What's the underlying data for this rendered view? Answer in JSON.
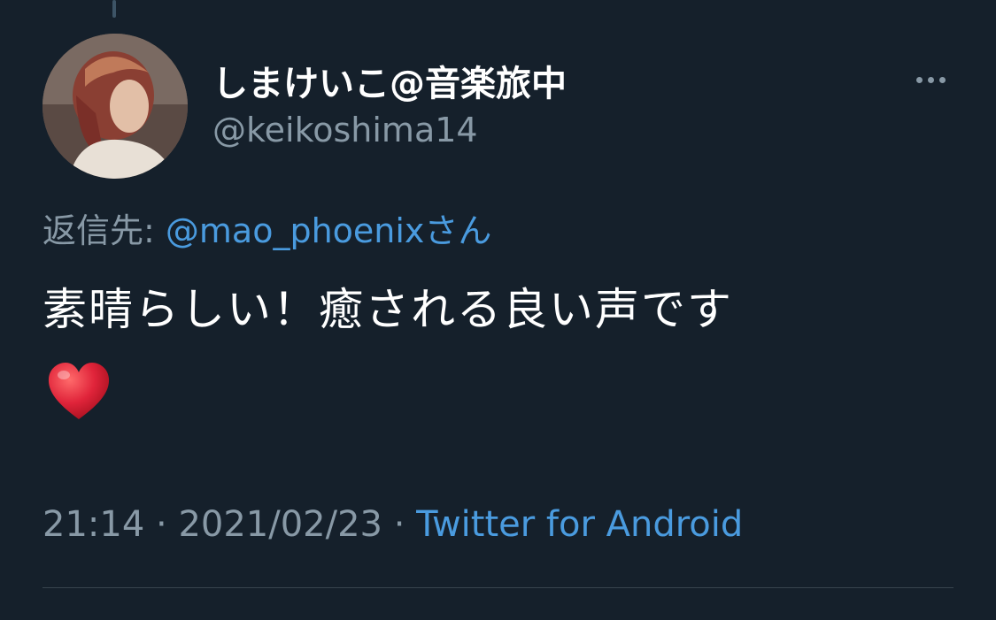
{
  "tweet": {
    "display_name": "しまけいこ@音楽旅中",
    "handle": "@keikoshima14",
    "reply_prefix": "返信先: ",
    "reply_mention": "@mao_phoenixさん",
    "text": "素晴らしい！癒される良い声です",
    "emoji_icon": "red-heart",
    "time": "21:14",
    "separator": " · ",
    "date": "2021/02/23",
    "source": "Twitter for Android"
  },
  "colors": {
    "background": "#15202b",
    "primary_text": "#ffffff",
    "secondary_text": "#8899a6",
    "link": "#4a9bdf",
    "divider": "#38444d",
    "heart": "#e0243a"
  }
}
